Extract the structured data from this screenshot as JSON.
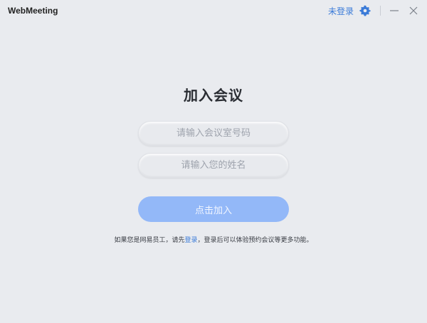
{
  "titlebar": {
    "app_title": "WebMeeting",
    "login_link": "未登录",
    "icons": [
      "gear-icon",
      "minimize-icon",
      "close-icon"
    ]
  },
  "main": {
    "heading": "加入会议",
    "meeting_id_placeholder": "请输入会议室号码",
    "meeting_id_value": "",
    "name_placeholder": "请输入您的姓名",
    "name_value": "",
    "join_label": "点击加入",
    "hint_prefix": "如果您是网易员工，请先",
    "hint_link": "登录",
    "hint_suffix": "，登录后可以体验预约会议等更多功能。"
  },
  "colors": {
    "background": "#e9ebef",
    "accent": "#3b7bd8",
    "join_button": "#93b8f8"
  }
}
